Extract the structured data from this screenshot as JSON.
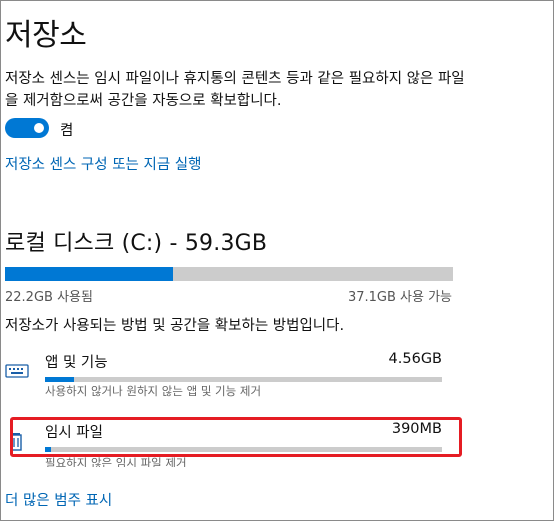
{
  "page": {
    "title": "저장소",
    "description": "저장소 센스는 임시 파일이나 휴지통의 콘텐츠 등과 같은 필요하지 않은 파일을 제거함으로써 공간을 자동으로 확보합니다.",
    "toggle_state": "켬",
    "configure_link": "저장소 센스 구성 또는 지금 실행"
  },
  "disk": {
    "title": "로컬 디스크 (C:) - 59.3GB",
    "used": "22.2GB 사용됨",
    "free": "37.1GB 사용 가능",
    "used_fraction": 0.374,
    "intro": "저장소가 사용되는 방법 및 공간을 확보하는 방법입니다."
  },
  "categories": [
    {
      "name": "앱 및 기능",
      "size": "4.56GB",
      "sub": "사용하지 않거나 원하지 않는 앱 및 기능 제거",
      "fraction": 0.074,
      "icon": "keyboard-icon"
    },
    {
      "name": "임시 파일",
      "size": "390MB",
      "sub": "필요하지 않은 임시 파일 제거",
      "fraction": 0.006,
      "icon": "trash-icon"
    }
  ],
  "more_link": "더 많은 범주 표시",
  "colors": {
    "accent": "#0078d4",
    "highlight": "#e51c23",
    "link": "#0066b4"
  }
}
